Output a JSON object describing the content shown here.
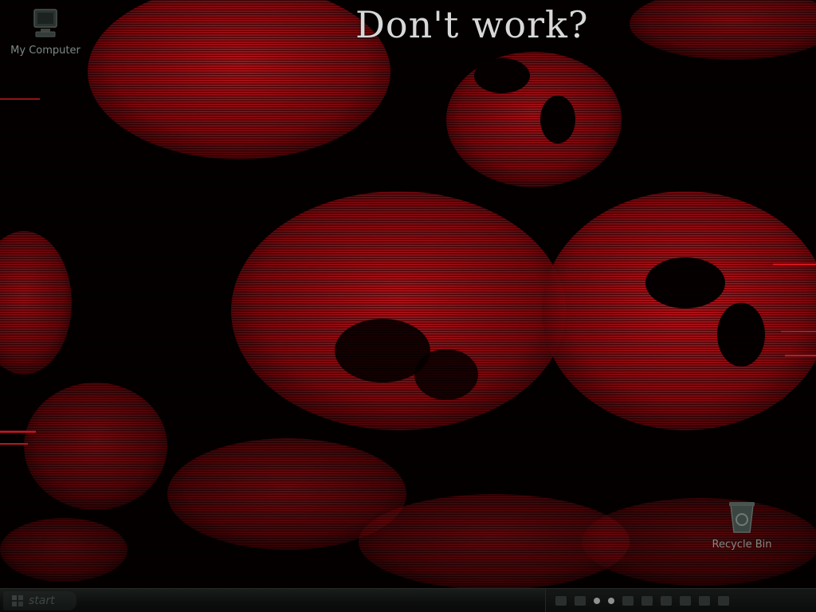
{
  "banner": {
    "text": "Don't work?"
  },
  "desktop_icons": {
    "my_computer": {
      "label": "My Computer",
      "icon": "computer-icon"
    },
    "recycle_bin": {
      "label": "Recycle Bin",
      "icon": "recycle-bin-icon"
    }
  },
  "taskbar": {
    "start_label": "start",
    "start_icon": "windows-logo-icon",
    "tray_icons": [
      "speaker-icon",
      "network-icon",
      "shield-icon",
      "battery-icon",
      "antivirus-icon",
      "update-icon",
      "security-icon",
      "volume-icon",
      "chat-icon",
      "disk-icon"
    ],
    "clock": ""
  },
  "colors": {
    "wallpaper_red": "#b8121a",
    "wallpaper_dark": "#050000",
    "banner_text": "#d8d8d8",
    "icon_label": "#7d8a84"
  }
}
